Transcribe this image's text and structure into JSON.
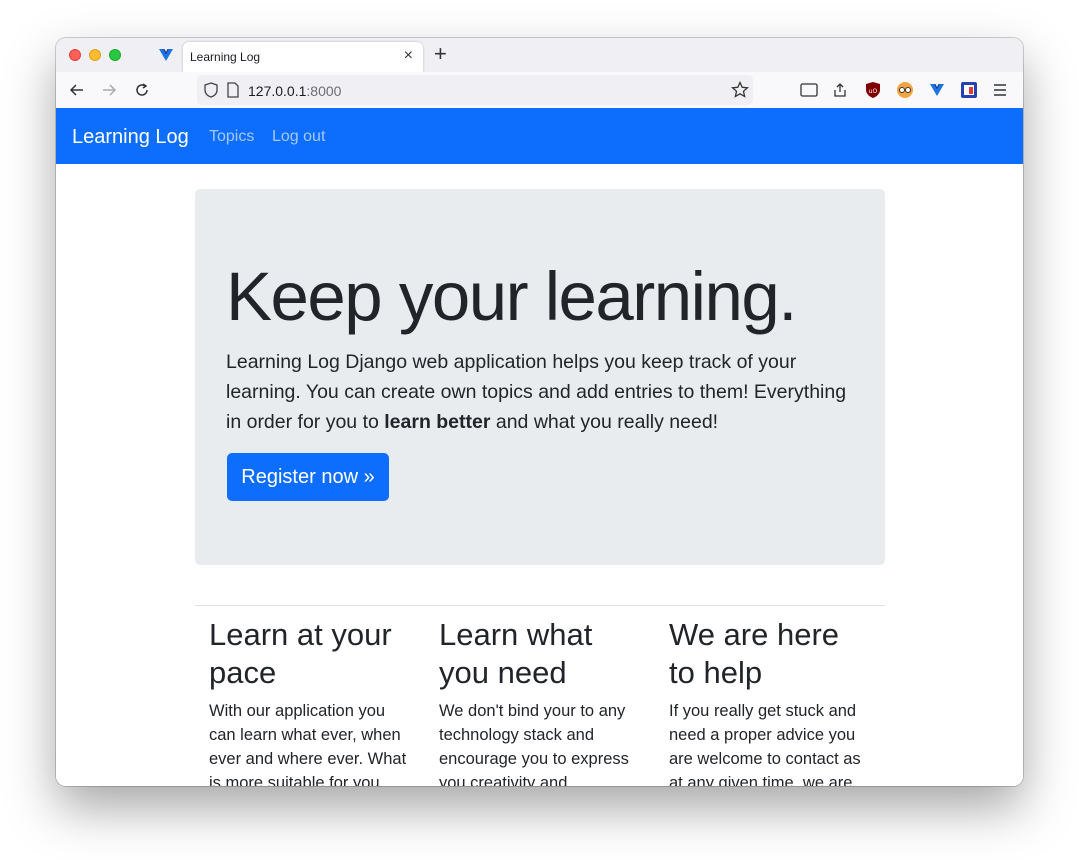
{
  "browser": {
    "tab_title": "Learning Log",
    "url_host": "127.0.0.1",
    "url_port": ":8000",
    "icons": [
      "back-arrow-icon",
      "forward-arrow-icon",
      "reload-icon",
      "shield-icon",
      "page-icon",
      "star-icon",
      "reader-view-icon",
      "share-icon",
      "ublock-extension-icon",
      "glasses-extension-icon",
      "vue-extension-icon",
      "flag-extension-icon",
      "menu-icon"
    ]
  },
  "navbar": {
    "brand": "Learning Log",
    "links": [
      {
        "label": "Topics"
      },
      {
        "label": "Log out"
      }
    ],
    "color": "#0d6efd"
  },
  "hero": {
    "title": "Keep your learning.",
    "lead_part1": "Learning Log Django web application helps you keep track of your learning. You can create own topics and add entries to them! Everything in order for you to ",
    "lead_bold": "learn better",
    "lead_part2": " and what you really need!",
    "button_label": "Register now »"
  },
  "features": [
    {
      "title": "Learn at your pace",
      "text": "With our application you can learn what ever, when ever and where ever. What is more suitable for you"
    },
    {
      "title": "Learn what you need",
      "text": "We don't bind your to any technology stack and encourage you to express you creativity and"
    },
    {
      "title": "We are here to help",
      "text": "If you really get stuck and need a proper advice you are welcome to contact as at any given time, we are"
    }
  ]
}
